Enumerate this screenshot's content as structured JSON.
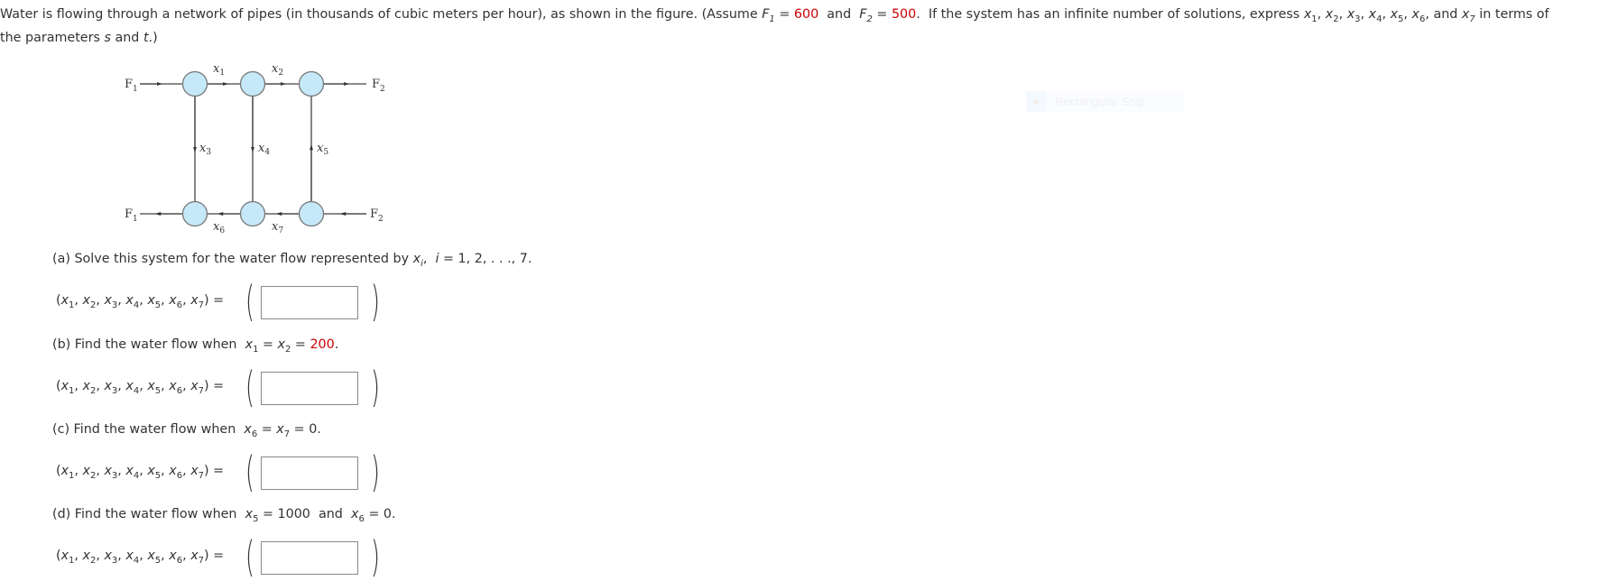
{
  "problem": {
    "intro_p1": "Water is flowing through a network of pipes (in thousands of cubic meters per hour), as shown in the figure. (Assume ",
    "F1_label": "F",
    "F1_sub": "1",
    "eq": " = ",
    "F1_value": "600",
    "and": "  and  ",
    "F2_label": "F",
    "F2_sub": "2",
    "F2_value": "500",
    "intro_p2": ".  If the system has an infinite number of solutions, express ",
    "var_list": [
      {
        "name": "x",
        "sub": "1"
      },
      {
        "name": "x",
        "sub": "2"
      },
      {
        "name": "x",
        "sub": "3"
      },
      {
        "name": "x",
        "sub": "4"
      },
      {
        "name": "x",
        "sub": "5"
      },
      {
        "name": "x",
        "sub": "6"
      }
    ],
    "and_last": " and ",
    "last_var": {
      "name": "x",
      "sub": "7"
    },
    "intro_p3": " in terms of",
    "line2_p1": "the parameters ",
    "param_s": "s",
    "line2_and": " and ",
    "param_t": "t",
    "line2_end": ".)"
  },
  "diagram": {
    "inflow_top_left": {
      "label": "F",
      "sub": "1"
    },
    "outflow_top_right": {
      "label": "F",
      "sub": "2"
    },
    "outflow_bottom_left": {
      "label": "F",
      "sub": "1"
    },
    "inflow_bottom_right": {
      "label": "F",
      "sub": "2"
    },
    "edges": [
      {
        "label": "x",
        "sub": "1",
        "from": "top-node-1",
        "to": "top-node-2"
      },
      {
        "label": "x",
        "sub": "2",
        "from": "top-node-2",
        "to": "top-node-3"
      },
      {
        "label": "x",
        "sub": "3",
        "from": "top-node-1",
        "to": "bottom-node-1"
      },
      {
        "label": "x",
        "sub": "4",
        "from": "top-node-2",
        "to": "bottom-node-2"
      },
      {
        "label": "x",
        "sub": "5",
        "from": "bottom-node-3",
        "to": "top-node-3"
      },
      {
        "label": "x",
        "sub": "6",
        "from": "bottom-node-2",
        "to": "bottom-node-1"
      },
      {
        "label": "x",
        "sub": "7",
        "from": "bottom-node-3",
        "to": "bottom-node-2"
      }
    ],
    "node_fill": "#c6e9f9",
    "node_stroke": "#777777"
  },
  "tuple_label": "(x1, x2, x3, x4, x5, x6, x7) =",
  "parts": [
    {
      "id": "a",
      "prefix": "(a) Solve this system for the water flow represented by ",
      "cond_html_parts": [
        {
          "t": "x",
          "i": true,
          "sub": "i"
        },
        {
          "t": ",  ",
          "i": false
        },
        {
          "t": "i",
          "i": true
        },
        {
          "t": " = 1, 2, . . ., 7.",
          "i": false
        }
      ],
      "answer_value": ""
    },
    {
      "id": "b",
      "prefix": "(b) Find the water flow when  ",
      "cond_html_parts": [
        {
          "t": "x",
          "i": true,
          "sub": "1"
        },
        {
          "t": " = ",
          "i": false
        },
        {
          "t": "x",
          "i": true,
          "sub": "2"
        },
        {
          "t": " = ",
          "i": false
        },
        {
          "t": "200",
          "i": false,
          "red": true
        },
        {
          "t": ".",
          "i": false
        }
      ],
      "answer_value": ""
    },
    {
      "id": "c",
      "prefix": "(c) Find the water flow when  ",
      "cond_html_parts": [
        {
          "t": "x",
          "i": true,
          "sub": "6"
        },
        {
          "t": " = ",
          "i": false
        },
        {
          "t": "x",
          "i": true,
          "sub": "7"
        },
        {
          "t": " = 0.",
          "i": false
        }
      ],
      "answer_value": ""
    },
    {
      "id": "d",
      "prefix": "(d) Find the water flow when  ",
      "cond_html_parts": [
        {
          "t": "x",
          "i": true,
          "sub": "5"
        },
        {
          "t": " = 1000  and  ",
          "i": false
        },
        {
          "t": "x",
          "i": true,
          "sub": "6"
        },
        {
          "t": " = 0.",
          "i": false
        }
      ],
      "answer_value": ""
    }
  ],
  "tuple_vars": [
    "1",
    "2",
    "3",
    "4",
    "5",
    "6",
    "7"
  ],
  "overlay": {
    "snip_label": "Rectangular Snip",
    "icon": "snip-record-icon"
  },
  "colors": {
    "given_value": "#cc0000",
    "text": "#333333"
  }
}
